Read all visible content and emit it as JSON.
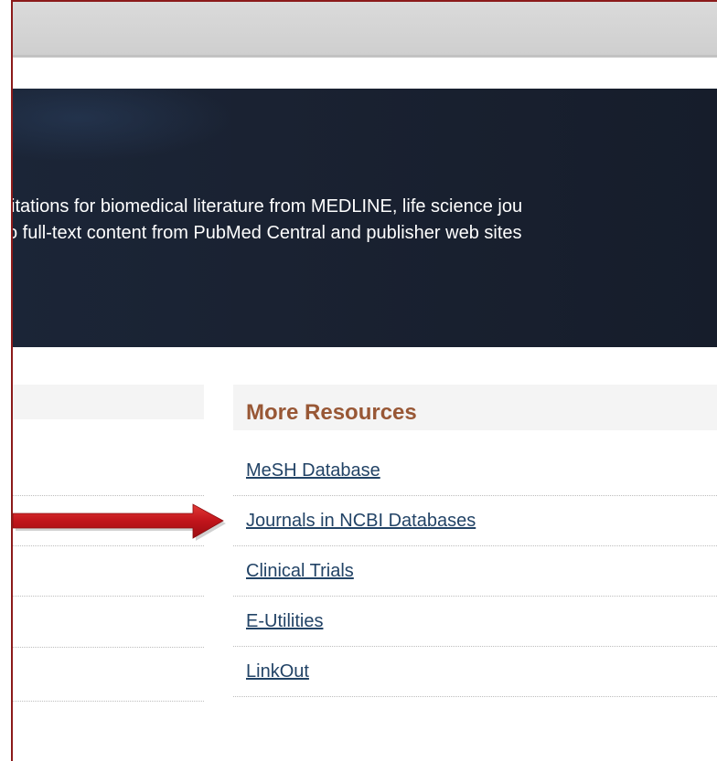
{
  "banner": {
    "description_line1": "itations for biomedical literature from MEDLINE, life science jou",
    "description_line2": "o full-text content from PubMed Central and publisher web sites"
  },
  "more_resources": {
    "title": "More Resources",
    "links": [
      {
        "label": "MeSH Database"
      },
      {
        "label": "Journals in NCBI Databases"
      },
      {
        "label": "Clinical Trials"
      },
      {
        "label": "E-Utilities"
      },
      {
        "label": "LinkOut"
      }
    ]
  },
  "annotation": {
    "arrow_color": "#c0141b",
    "arrow_target": "Journals in NCBI Databases"
  }
}
